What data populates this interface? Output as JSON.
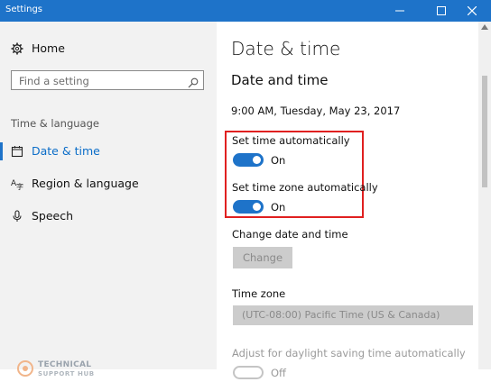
{
  "window": {
    "title": "Settings"
  },
  "sidebar": {
    "home_label": "Home",
    "search_placeholder": "Find a setting",
    "section_heading": "Time & language",
    "items": [
      {
        "label": "Date & time",
        "icon": "calendar-icon",
        "active": true
      },
      {
        "label": "Region & language",
        "icon": "region-language-icon",
        "active": false
      },
      {
        "label": "Speech",
        "icon": "microphone-icon",
        "active": false
      }
    ]
  },
  "main": {
    "page_title": "Date & time",
    "section_title": "Date and time",
    "current_datetime": "9:00 AM, Tuesday, May 23, 2017",
    "set_time_auto": {
      "label": "Set time automatically",
      "state": "On"
    },
    "set_timezone_auto": {
      "label": "Set time zone automatically",
      "state": "On"
    },
    "change_label": "Change date and time",
    "change_button": "Change",
    "timezone_label": "Time zone",
    "timezone_value": "(UTC-08:00) Pacific Time (US & Canada)",
    "dst_label": "Adjust for daylight saving time automatically",
    "dst_state": "Off"
  },
  "watermark": {
    "line1": "TECHNICAL",
    "line2": "SUPPORT HUB"
  },
  "colors": {
    "accent": "#1e73c9",
    "highlight": "#e02020",
    "sidebar_bg": "#f2f2f2"
  }
}
